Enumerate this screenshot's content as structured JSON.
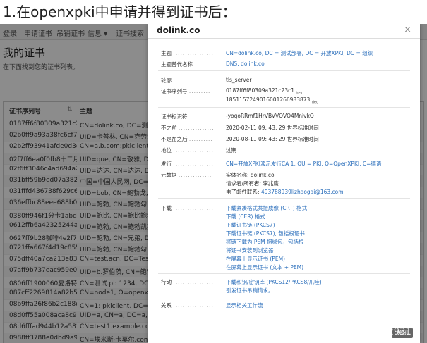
{
  "heading": "1.在openxpki中申请并得到证书后：",
  "nav": {
    "items": [
      "登录",
      "申请证书",
      "吊销证书",
      "信息 ▾",
      "证书搜索"
    ]
  },
  "page": {
    "title": "我的证书",
    "subtitle": "在下面找到您的证书列表。"
  },
  "list": {
    "headers": [
      "证书序列号",
      "主题"
    ],
    "rows": [
      {
        "serial": "0187ff6f80309a321c23c1",
        "subject": "CN=dolink.co, DC=测试"
      },
      {
        "serial": "02b0ff9a93a38fc6cf7971",
        "subject": "UID=卡普林, CN=克劳迪奥"
      },
      {
        "serial": "02b2ff93941afde0d3d26a",
        "subject": "CN=a.b.com:pkiclient, DC"
      },
      {
        "serial": "02f7ff6ea0f0fb8十二月4fd5",
        "subject": "UID=que, CN=敬雅, DC="
      },
      {
        "serial": "02f6ff3046c4ad694a2bc2",
        "subject": "UID=达达, CN=达达, DC="
      },
      {
        "serial": "031bff59b9ed07a382e91a",
        "subject": "中国=中国人民网, DC="
      },
      {
        "serial": "031fffd436738f629c640e",
        "subject": "UID=bob, CN=鲍勃戈, DC="
      },
      {
        "serial": "036effbc88eee688b0e715",
        "subject": "UID=鲍勃, CN=鲍勃勾了"
      },
      {
        "serial": "0380ff946f1分卡1abd99d",
        "subject": "UID=鲍比, CN=鲍比鲍勃"
      },
      {
        "serial": "0612ffb6a42325244ad30c",
        "subject": "UID=鲍勃, CN=鲍勃凯斯"
      },
      {
        "serial": "0627ff9b28咖啡4e2f71",
        "subject": "UID=鲍勃, CN=兄弟, DC="
      },
      {
        "serial": "0721ffa667f4d19c855",
        "subject": "UID=鲍勃, CN=鲍勃勾了"
      },
      {
        "serial": "075dff40a7ca213e83ed5b",
        "subject": "CN=test.acn, DC=Test De"
      },
      {
        "serial": "07aff9b737eac959e00d3",
        "subject": "UID=b.罗伯茨, CN=鲍勃·罗"
      },
      {
        "serial": "0806ff1900060夏洛特64d",
        "subject": "CN=测试.pl: 1234, DC=测试"
      },
      {
        "serial": "087cff2269814a82b5671a",
        "subject": "CN=node1, O=openxpki"
      },
      {
        "serial": "08b9ffa26f86b2c188d3f2",
        "subject": "CN=1: pkiclient, DC=测试"
      },
      {
        "serial": "08d0ff55a008aca8c998fa",
        "subject": "UID=a, CN=a, DC=a, DC"
      },
      {
        "serial": "08d6fffad944b12a581d3f",
        "subject": "CN=test1.example.com, D"
      },
      {
        "serial": "0988ff3788e0dbd9a9873b",
        "subject": "CN=埃米斯·卡莫尔.com: 埃"
      }
    ]
  },
  "modal": {
    "title": "dolink.co",
    "close": "×",
    "fields": {
      "subject_label": "主题",
      "subject_value": "CN=dolink.co, DC = 测试部署, DC = 开放XPKI, DC = 组织",
      "san_label": "主题替代名称",
      "san_value": "DNS: dolink.co",
      "profile_label": "轮廓",
      "profile_value": "tls_server",
      "serial_label": "证书序列号",
      "serial_hex": "0187ff6f80309a321c23c1",
      "serial_hex_suffix": "hex",
      "serial_dec": "1851157249016001266983873",
      "serial_dec_suffix": "dec",
      "identifier_label": "证书标识符",
      "identifier_value": "-yoqoRRmf1HrVBVVQVQ4MnivkQ",
      "notbefore_label": "不之前",
      "notbefore_value": "2020-02-11 09: 43: 29 世界标准时间",
      "notafter_label": "不是在之后",
      "notafter_value": "2020-08-11 09: 43: 29 世界标准时间",
      "status_label": "地位",
      "status_value": "过期",
      "issuer_label": "发行",
      "issuer_value": "CN=开放XPKI演示发行CA 1, OU = PKI, O=OpenXPKI, C=德语",
      "meta_label": "元数据",
      "meta_entity": "实体名称:  dolink.co",
      "meta_requester": "请求者/所有者:  李兆鹰",
      "meta_email_prefix": "电子邮件联系:  ",
      "meta_email": "493788939lizhaogai@163.com",
      "download_label": "下载",
      "downloads": [
        "下载紧凑格式共振成像 (CRT) 格式",
        "下载 (CER) 格式",
        "下载证书链 (PKCS7)",
        "下载证书链 (PKCS7), 包括根证书",
        "将链下载为 PEM 捆绑包，包括根",
        "将证书安装到浏览器",
        "在屏幕上显示证书 (PEM)",
        "在屏幕上显示证书 (文本 + PEM)"
      ],
      "action_label": "行动",
      "actions": [
        "下载私钥/密钥库 (PKCS12/PKCS8/爪哇)",
        "引发证书吊销请求。"
      ],
      "relations_label": "关系",
      "relations_value": "显示相关工作流"
    },
    "footer_button": "关闭"
  },
  "watermark": "CSDN @m0_73429317"
}
